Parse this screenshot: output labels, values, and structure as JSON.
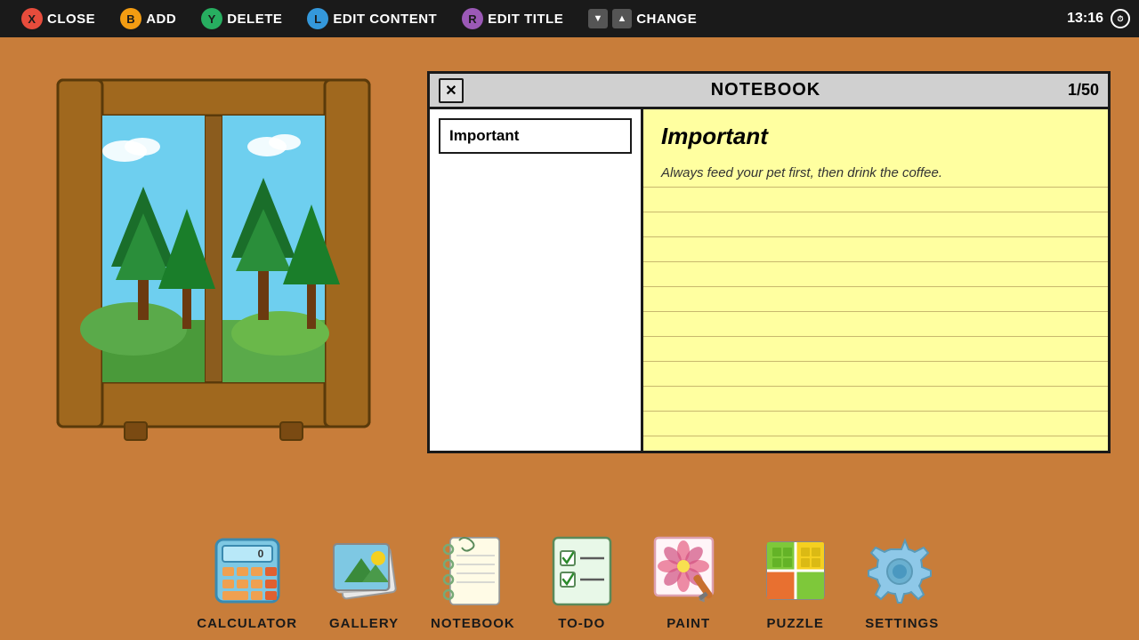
{
  "topbar": {
    "items": [
      {
        "btn": "X",
        "btn_class": "btn-x",
        "label": "CLOSE"
      },
      {
        "btn": "B",
        "btn_class": "btn-b",
        "label": "ADD"
      },
      {
        "btn": "Y",
        "btn_class": "btn-y",
        "label": "DELETE"
      },
      {
        "btn": "L",
        "btn_class": "btn-l",
        "label": "EDIT CONTENT"
      },
      {
        "btn": "R",
        "btn_class": "btn-r",
        "label": "EDIT TITLE"
      }
    ],
    "change_label": "CHANGE",
    "time": "13:16"
  },
  "notebook": {
    "title": "NOTEBOOK",
    "page_count": "1/50",
    "entry_title": "Important",
    "content_title": "Important",
    "content_text": "Always feed your pet first, then drink the coffee."
  },
  "apps": [
    {
      "id": "calculator",
      "label": "CALCULATOR"
    },
    {
      "id": "gallery",
      "label": "GALLERY"
    },
    {
      "id": "notebook",
      "label": "NOTEBOOK"
    },
    {
      "id": "todo",
      "label": "TO-DO"
    },
    {
      "id": "paint",
      "label": "PAINT"
    },
    {
      "id": "puzzle",
      "label": "PUZZLE"
    },
    {
      "id": "settings",
      "label": "SETTINGS"
    }
  ]
}
